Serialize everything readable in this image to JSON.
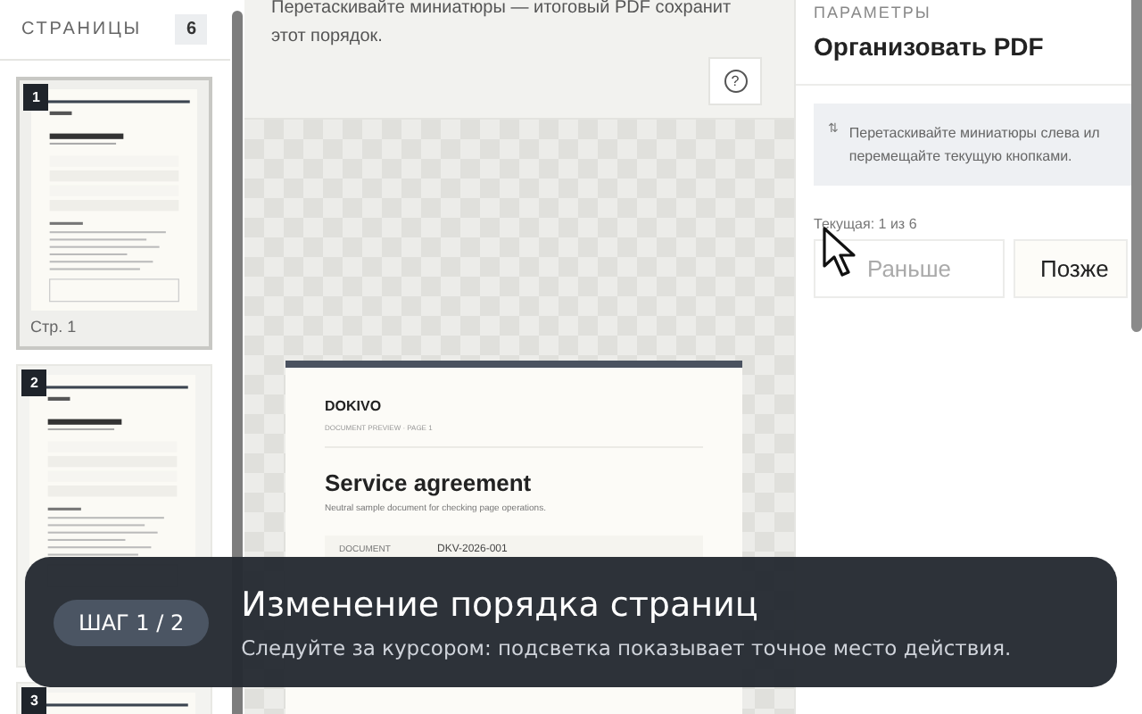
{
  "sidebar": {
    "title": "СТРАНИЦЫ",
    "count": "6",
    "pages": [
      {
        "number": "1",
        "caption": "Стр. 1",
        "selected": true
      },
      {
        "number": "2",
        "selected": false
      },
      {
        "number": "3",
        "selected": false
      }
    ]
  },
  "workspace": {
    "hint": "Перетаскивайте миниатюры — итоговый PDF сохранит этот порядок.",
    "help": "?",
    "preview": {
      "brand": "DOKIVO",
      "crumb": "DOCUMENT PREVIEW · PAGE 1",
      "title": "Service agreement",
      "subtitle": "Neutral sample document for checking page operations.",
      "rows": [
        {
          "label": "DOCUMENT",
          "value": "DKV-2026-001"
        }
      ]
    }
  },
  "panel": {
    "section": "ПАРАМЕТРЫ",
    "title": "Организовать PDF",
    "info_icon": "⇅",
    "info": "Перетаскивайте миниатюры слева ил\nперемещайте текущую кнопками.",
    "current": "Текущая: 1 из 6",
    "buttons": [
      {
        "label": "Раньше",
        "disabled": true
      },
      {
        "label": "Позже",
        "disabled": false
      }
    ]
  },
  "tour": {
    "step": "ШАГ 1 / 2",
    "title": "Изменение порядка страниц",
    "text": "Следуйте за курсором: подсветка показывает точное место действия."
  }
}
